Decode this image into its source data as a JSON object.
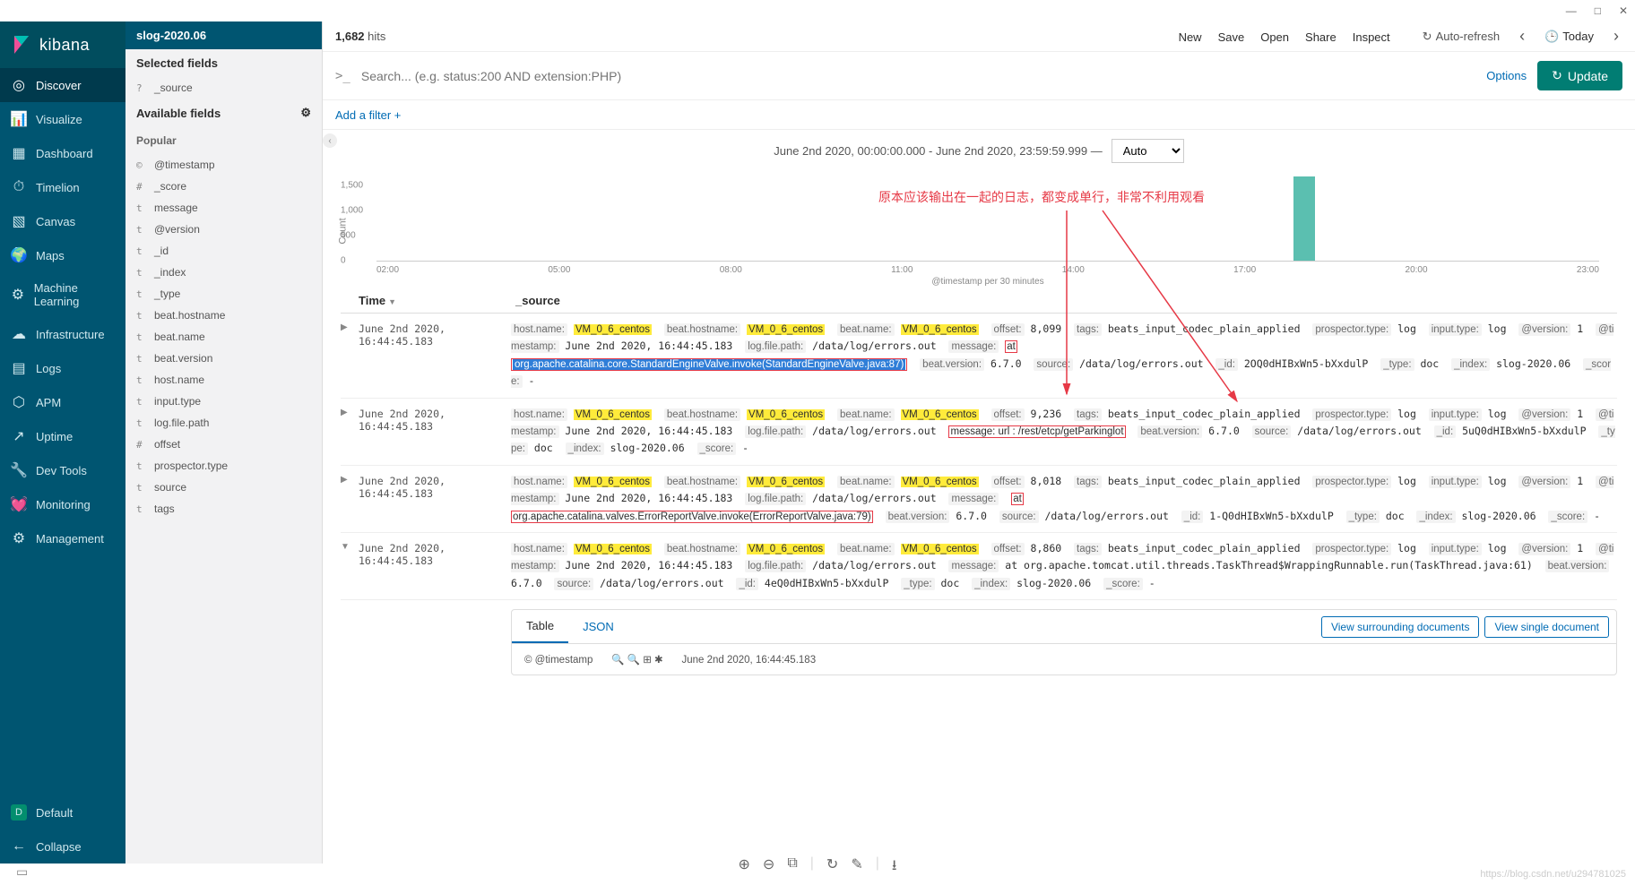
{
  "window": {
    "min": "—",
    "max": "□",
    "close": "✕"
  },
  "brand": "kibana",
  "nav": [
    {
      "label": "Discover",
      "active": true
    },
    {
      "label": "Visualize"
    },
    {
      "label": "Dashboard"
    },
    {
      "label": "Timelion"
    },
    {
      "label": "Canvas"
    },
    {
      "label": "Maps"
    },
    {
      "label": "Machine Learning"
    },
    {
      "label": "Infrastructure"
    },
    {
      "label": "Logs"
    },
    {
      "label": "APM"
    },
    {
      "label": "Uptime"
    },
    {
      "label": "Dev Tools"
    },
    {
      "label": "Monitoring"
    },
    {
      "label": "Management"
    }
  ],
  "nav_footer": {
    "default": "Default",
    "default_badge": "D",
    "collapse": "Collapse"
  },
  "fields": {
    "index": "slog-2020.06",
    "selected_title": "Selected fields",
    "selected": [
      {
        "t": "?",
        "n": "_source"
      }
    ],
    "available_title": "Available fields",
    "popular_title": "Popular",
    "popular": [
      {
        "t": "©",
        "n": "@timestamp"
      }
    ],
    "list": [
      {
        "t": "#",
        "n": "_score"
      },
      {
        "t": "t",
        "n": "message"
      },
      {
        "t": "t",
        "n": "@version"
      },
      {
        "t": "t",
        "n": "_id"
      },
      {
        "t": "t",
        "n": "_index"
      },
      {
        "t": "t",
        "n": "_type"
      },
      {
        "t": "t",
        "n": "beat.hostname"
      },
      {
        "t": "t",
        "n": "beat.name"
      },
      {
        "t": "t",
        "n": "beat.version"
      },
      {
        "t": "t",
        "n": "host.name"
      },
      {
        "t": "t",
        "n": "input.type"
      },
      {
        "t": "t",
        "n": "log.file.path"
      },
      {
        "t": "#",
        "n": "offset"
      },
      {
        "t": "t",
        "n": "prospector.type"
      },
      {
        "t": "t",
        "n": "source"
      },
      {
        "t": "t",
        "n": "tags"
      }
    ]
  },
  "topbar": {
    "hits_count": "1,682",
    "hits_label": "hits",
    "links": [
      "New",
      "Save",
      "Open",
      "Share",
      "Inspect"
    ],
    "autorefresh": "Auto-refresh",
    "today": "Today"
  },
  "search": {
    "prompt": ">_",
    "placeholder": "Search... (e.g. status:200 AND extension:PHP)",
    "options": "Options",
    "update": "Update"
  },
  "filter": {
    "add": "Add a filter +"
  },
  "timerange": {
    "text": "June 2nd 2020, 00:00:00.000 - June 2nd 2020, 23:59:59.999 —",
    "interval": "Auto"
  },
  "chart_data": {
    "type": "bar",
    "ylabel": "Count",
    "xlabel": "@timestamp per 30 minutes",
    "y_ticks": [
      0,
      500,
      1000,
      1500
    ],
    "x_ticks": [
      "02:00",
      "05:00",
      "08:00",
      "11:00",
      "14:00",
      "17:00",
      "20:00",
      "23:00"
    ],
    "series": [
      {
        "name": "hits",
        "values": [
          {
            "x": "17:00",
            "y": 1682
          }
        ]
      }
    ],
    "bar_position_pct": 75
  },
  "annotation": "原本应该输出在一起的日志，都变成单行，非常不利用观看",
  "table": {
    "headers": {
      "time": "Time",
      "source": "_source"
    },
    "rows": [
      {
        "exp": "▶",
        "time": "June 2nd 2020, 16:44:45.183",
        "kv": [
          [
            "host.name:",
            "VM_0_6_centos",
            1
          ],
          [
            "beat.hostname:",
            "VM_0_6_centos",
            1
          ],
          [
            "beat.name:",
            "VM_0_6_centos",
            1
          ],
          [
            "offset:",
            "8,099",
            0
          ],
          [
            "tags:",
            "beats_input_codec_plain_applied",
            0
          ],
          [
            "prospector.type:",
            "log",
            0
          ],
          [
            "input.type:",
            "log",
            0
          ],
          [
            "@version:",
            "1",
            0
          ],
          [
            "@timestamp:",
            "June 2nd 2020, 16:44:45.183",
            0
          ],
          [
            "log.file.path:",
            "/data/log/errors.out",
            0
          ]
        ],
        "msg_box1": " at ",
        "msg_sel": "org.apache.catalina.core.StandardEngineValve.invoke(StandardEngineValve.java:87)",
        "tail": [
          [
            "beat.version:",
            "6.7.0"
          ],
          [
            "source:",
            "/data/log/errors.out"
          ],
          [
            "_id:",
            "2OQ0dHIBxWn5-bXxdulP"
          ],
          [
            "_type:",
            "doc"
          ],
          [
            "_index:",
            "slog-2020.06"
          ],
          [
            "_score:",
            "-"
          ]
        ]
      },
      {
        "exp": "▶",
        "time": "June 2nd 2020, 16:44:45.183",
        "kv": [
          [
            "host.name:",
            "VM_0_6_centos",
            1
          ],
          [
            "beat.hostname:",
            "VM_0_6_centos",
            1
          ],
          [
            "beat.name:",
            "VM_0_6_centos",
            1
          ],
          [
            "offset:",
            "9,236",
            0
          ],
          [
            "tags:",
            "beats_input_codec_plain_applied",
            0
          ],
          [
            "prospector.type:",
            "log",
            0
          ],
          [
            "input.type:",
            "log",
            0
          ],
          [
            "@version:",
            "1",
            0
          ],
          [
            "@timestamp:",
            "June 2nd 2020, 16:44:45.183",
            0
          ],
          [
            "log.file.path:",
            "/data/log/errors.out",
            0
          ]
        ],
        "msg_box2": "message: url : /rest/etcp/getParkinglot",
        "tail": [
          [
            "beat.version:",
            "6.7.0"
          ],
          [
            "source:",
            "/data/log/errors.out"
          ],
          [
            "_id:",
            "5uQ0dHIBxWn5-bXxdulP"
          ],
          [
            "_type:",
            "doc"
          ],
          [
            "_index:",
            "slog-2020.06"
          ],
          [
            "_score:",
            "-"
          ]
        ]
      },
      {
        "exp": "▶",
        "time": "June 2nd 2020, 16:44:45.183",
        "kv": [
          [
            "host.name:",
            "VM_0_6_centos",
            1
          ],
          [
            "beat.hostname:",
            "VM_0_6_centos",
            1
          ],
          [
            "beat.name:",
            "VM_0_6_centos",
            1
          ],
          [
            "offset:",
            "8,018",
            0
          ],
          [
            "tags:",
            "beats_input_codec_plain_applied",
            0
          ],
          [
            "prospector.type:",
            "log",
            0
          ],
          [
            "input.type:",
            "log",
            0
          ],
          [
            "@version:",
            "1",
            0
          ],
          [
            "@timestamp:",
            "June 2nd 2020, 16:44:45.183",
            0
          ],
          [
            "log.file.path:",
            "/data/log/errors.out",
            0
          ],
          [
            "message:",
            "",
            0
          ]
        ],
        "msg_box1": "at",
        "msg_box3": "org.apache.catalina.valves.ErrorReportValve.invoke(ErrorReportValve.java:79)",
        "tail": [
          [
            "beat.version:",
            "6.7.0"
          ],
          [
            "source:",
            "/data/log/errors.out"
          ],
          [
            "_id:",
            "1-Q0dHIBxWn5-bXxdulP"
          ],
          [
            "_type:",
            "doc"
          ],
          [
            "_index:",
            "slog-2020.06"
          ],
          [
            "_score:",
            "-"
          ]
        ]
      },
      {
        "exp": "▼",
        "time": "June 2nd 2020, 16:44:45.183",
        "kv": [
          [
            "host.name:",
            "VM_0_6_centos",
            1
          ],
          [
            "beat.hostname:",
            "VM_0_6_centos",
            1
          ],
          [
            "beat.name:",
            "VM_0_6_centos",
            1
          ],
          [
            "offset:",
            "8,860",
            0
          ],
          [
            "tags:",
            "beats_input_codec_plain_applied",
            0
          ],
          [
            "prospector.type:",
            "log",
            0
          ],
          [
            "input.type:",
            "log",
            0
          ],
          [
            "@version:",
            "1",
            0
          ],
          [
            "@timestamp:",
            "June 2nd 2020, 16:44:45.183",
            0
          ],
          [
            "log.file.path:",
            "/data/log/errors.out",
            0
          ],
          [
            "message:",
            " at org.apache.tomcat.util.threads.TaskThread$WrappingRunnable.run(TaskThread.java:61)",
            0
          ],
          [
            "beat.version:",
            "6.7.0",
            0
          ],
          [
            "source:",
            "/data/log/errors.out",
            0
          ],
          [
            "_id:",
            "4eQ0dHIBxWn5-bXxdulP",
            0
          ],
          [
            "_type:",
            "doc",
            0
          ],
          [
            "_index:",
            "slog-2020.06",
            0
          ],
          [
            "_score:",
            "-",
            0
          ]
        ]
      }
    ]
  },
  "detail": {
    "tabs": [
      "Table",
      "JSON"
    ],
    "actions": [
      "View surrounding documents",
      "View single document"
    ],
    "body_key": "© @timestamp",
    "body_icons": "🔍 🔍 ⊞ ✱",
    "body_val": "June 2nd 2020, 16:44:45.183"
  },
  "watermark": "https://blog.csdn.net/u294781025"
}
